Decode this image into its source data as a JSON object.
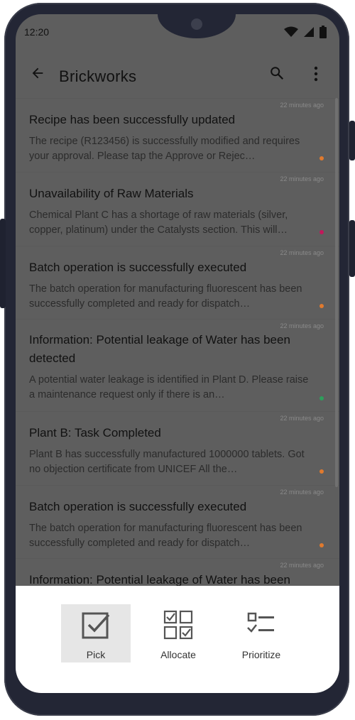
{
  "status": {
    "time": "12:20"
  },
  "app": {
    "title": "Brickworks"
  },
  "notifications": [
    {
      "timestamp": "22 minutes ago",
      "title": "Recipe has been successfully updated",
      "body": "The recipe (R123456) is successfully modified and requires your approval. Please tap the Approve or Rejec…",
      "dot_color": "#e07a2e"
    },
    {
      "timestamp": "22 minutes ago",
      "title": "Unavailability of Raw Materials",
      "body": "Chemical Plant C has a shortage of raw materials (silver, copper, platinum) under the Catalysts section. This will…",
      "dot_color": "#c2185b"
    },
    {
      "timestamp": "22 minutes ago",
      "title": "Batch operation is successfully executed",
      "body": "The batch operation for manufacturing fluorescent has been successfully completed and ready for dispatch…",
      "dot_color": "#e07a2e"
    },
    {
      "timestamp": "22 minutes ago",
      "title": "Information: Potential leakage of Water has been detected",
      "body": "A potential water leakage is identified in Plant D. Please raise a maintenance request only if there is an…",
      "dot_color": "#2e9e5b"
    },
    {
      "timestamp": "22 minutes ago",
      "title": "Plant B: Task Completed",
      "body": "Plant B has successfully manufactured 1000000 tablets. Got no objection certificate from UNICEF All the…",
      "dot_color": "#e07a2e"
    },
    {
      "timestamp": "22 minutes ago",
      "title": "Batch operation is successfully executed",
      "body": "The batch operation for manufacturing fluorescent has been successfully completed and ready for dispatch…",
      "dot_color": "#e07a2e"
    },
    {
      "timestamp": "22 minutes ago",
      "title": "Information: Potential leakage of Water has been",
      "body": "",
      "dot_color": ""
    }
  ],
  "actions": {
    "pick": "Pick",
    "allocate": "Allocate",
    "prioritize": "Prioritize"
  }
}
